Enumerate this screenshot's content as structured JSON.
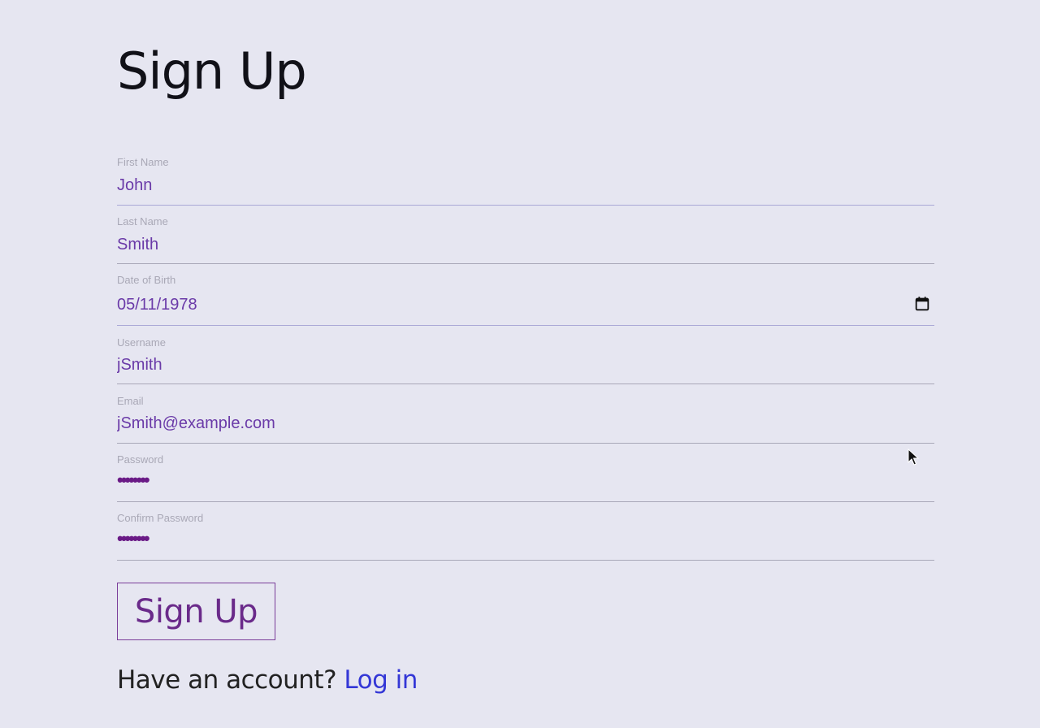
{
  "page": {
    "title": "Sign Up"
  },
  "form": {
    "fields": [
      {
        "label": "First Name",
        "value": "John"
      },
      {
        "label": "Last Name",
        "value": "Smith"
      },
      {
        "label": "Date of Birth",
        "value": "05/11/1978",
        "icon": "calendar-icon"
      },
      {
        "label": "Username",
        "value": "jSmith"
      },
      {
        "label": "Email",
        "value": "jSmith@example.com"
      },
      {
        "label": "Password",
        "value": "••••••••"
      },
      {
        "label": "Confirm Password",
        "value": "••••••••"
      }
    ],
    "submit_label": "Sign Up"
  },
  "footer": {
    "prompt": "Have an account? ",
    "link_label": "Log in"
  },
  "colors": {
    "background": "#e6e6f1",
    "input_text": "#6a3aa8",
    "link": "#3437d6",
    "button_border": "#7b3e9a"
  }
}
